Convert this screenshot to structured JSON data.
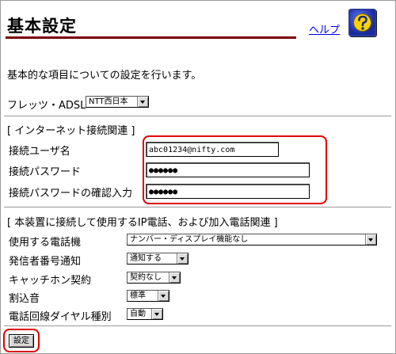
{
  "header": {
    "title": "基本設定",
    "help_label": "ヘルプ"
  },
  "description": "基本的な項目についての設定を行います。",
  "flets": {
    "label": "フレッツ・ADSL",
    "selected": "NTT西日本"
  },
  "internet": {
    "section_title": "[ インターネット接続関連 ]",
    "user_label": "接続ユーザ名",
    "user_value": "abc01234@nifty.com",
    "password_label": "接続パスワード",
    "password_value": "●●●●●●",
    "confirm_label": "接続パスワードの確認入力",
    "confirm_value": "●●●●●●"
  },
  "phone": {
    "section_title": "[ 本装置に接続して使用するIP電話、および加入電話関連 ]",
    "device_label": "使用する電話機",
    "device_value": "ナンバー・ディスプレイ機能なし",
    "caller_id_label": "発信者番号通知",
    "caller_id_value": "通知する",
    "catch_label": "キャッチホン契約",
    "catch_value": "契約なし",
    "interrupt_label": "割込音",
    "interrupt_value": "標準",
    "dial_label": "電話回線ダイヤル種別",
    "dial_value": "自動"
  },
  "submit_label": "設定",
  "colors": {
    "title_rule": "#7a0000",
    "highlight": "#e00000",
    "link": "#0000ee"
  }
}
